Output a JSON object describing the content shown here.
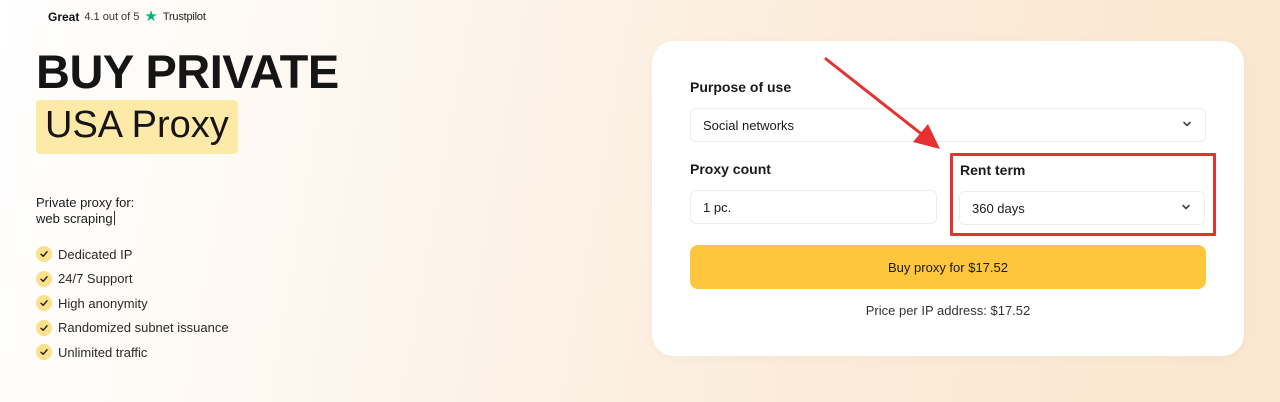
{
  "rating": {
    "label": "Great",
    "score": "4.1 out of 5",
    "brand": "Trustpilot",
    "star_color": "#00b67a"
  },
  "hero": {
    "title": "BUY PRIVATE",
    "subtitle": "USA Proxy",
    "highlight_color": "#fde9a8"
  },
  "purpose_blurb": {
    "label": "Private proxy for:",
    "typed_value": "web scraping"
  },
  "features": [
    "Dedicated IP",
    "24/7 Support",
    "High anonymity",
    "Randomized subnet issuance",
    "Unlimited traffic"
  ],
  "form": {
    "purpose": {
      "label": "Purpose of use",
      "value": "Social networks"
    },
    "count": {
      "label": "Proxy count",
      "value": "1 pc."
    },
    "term": {
      "label": "Rent term",
      "value": "360 days"
    },
    "buy_button": "Buy proxy for $17.52",
    "price_note": "Price per IP address: $17.52"
  },
  "colors": {
    "accent": "#fdc63d",
    "annotation": "#e63131"
  }
}
